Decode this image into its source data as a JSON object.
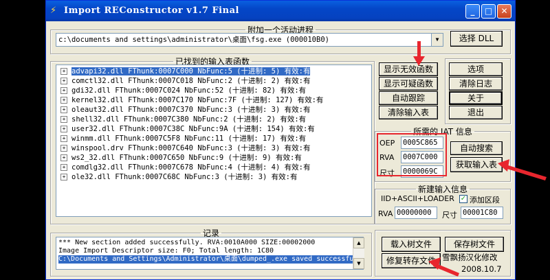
{
  "window": {
    "title": "Import REConstructor v1.7 Final",
    "min_symbol": "_",
    "max_symbol": "□",
    "close_symbol": "✕"
  },
  "attach": {
    "legend": "附加一个活动进程",
    "process": "c:\\documents and settings\\administrator\\桌面\\fsg.exe (000010B0)",
    "select_dll_label": "选择 DLL"
  },
  "imports": {
    "legend": "已找到的输入表函数",
    "rows": [
      "advapi32.dll FThunk:0007C000 NbFunc:5 (十进制: 5) 有效:有",
      "comctl32.dll FThunk:0007C018 NbFunc:2 (十进制: 2) 有效:有",
      "gdi32.dll FThunk:0007C024 NbFunc:52 (十进制: 82) 有效:有",
      "kernel32.dll FThunk:0007C170 NbFunc:7F (十进制: 127) 有效:有",
      "oleaut32.dll FThunk:0007C370 NbFunc:3 (十进制: 3) 有效:有",
      "shell32.dll FThunk:0007C380 NbFunc:2 (十进制: 2) 有效:有",
      "user32.dll FThunk:0007C38C NbFunc:9A (十进制: 154) 有效:有",
      "winmm.dll FThunk:0007C5F8 NbFunc:11 (十进制: 17) 有效:有",
      "winspool.drv FThunk:0007C640 NbFunc:3 (十进制: 3) 有效:有",
      "ws2_32.dll FThunk:0007C650 NbFunc:9 (十进制: 9) 有效:有",
      "comdlg32.dll FThunk:0007C678 NbFunc:4 (十进制: 4) 有效:有",
      "ole32.dll FThunk:0007C68C NbFunc:3 (十进制: 3) 有效:有"
    ],
    "show_invalid_label": "显示无效函数",
    "show_suspect_label": "显示可疑函数",
    "auto_trace_label": "自动跟踪",
    "clear_imports_label": "清除输入表"
  },
  "side": {
    "options_label": "选项",
    "clear_log_label": "清除日志",
    "about_label": "关于",
    "exit_label": "退出"
  },
  "iat": {
    "legend": "所需的 IAT 信息",
    "oep_label": "OEP",
    "oep_value": "0005C865",
    "rva_label": "RVA",
    "rva_value": "0007C000",
    "size_label": "尺寸",
    "size_value": "0000069C",
    "auto_search_label": "自动搜索",
    "get_imports_label": "获取输入表"
  },
  "new_import": {
    "legend": "新建输入信息",
    "mode_label": "IID+ASCII+LOADER",
    "add_section_label": "添加区段",
    "add_section_checked": true,
    "rva_label": "RVA",
    "rva_value": "00000000",
    "size_label": "尺寸",
    "size_value": "00001C80"
  },
  "log": {
    "legend": "记录",
    "lines": [
      "*** New section added successfully. RVA:0010A000 SIZE:00002000",
      "Image Import Descriptor size: F0; Total length: 1C80",
      "C:\\Documents and Settings\\Administrator\\桌面\\dumped_.exe saved successfully"
    ]
  },
  "tree_actions": {
    "load_tree_label": "载入树文件",
    "save_tree_label": "保存树文件",
    "fix_dump_label": "修复转存文件"
  },
  "credit": {
    "author": "雪飘扬汉化修改",
    "date": "2008.10.7"
  },
  "colors": {
    "titlebar": "#0446c7",
    "selection": "#316ac5",
    "annotation_red": "#e8262e"
  }
}
